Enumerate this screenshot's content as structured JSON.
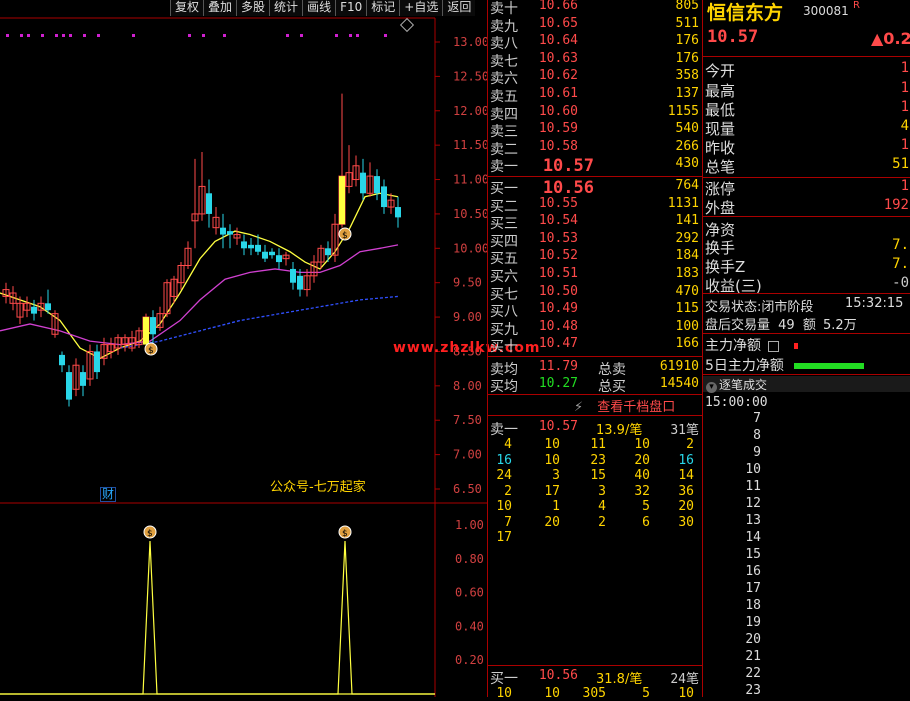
{
  "toolbar": {
    "buttons": [
      "复权",
      "叠加",
      "多股",
      "统计",
      "画线",
      "F10",
      "标记",
      "+自选",
      "返回"
    ]
  },
  "chart": {
    "y_ticks": [
      "13.00",
      "12.50",
      "12.00",
      "11.50",
      "11.00",
      "10.50",
      "10.00",
      "9.50",
      "9.00",
      "8.50",
      "8.00",
      "7.50",
      "7.00",
      "6.50"
    ],
    "indicator_ticks": [
      "1.00",
      "0.80",
      "0.60",
      "0.40",
      "0.20"
    ],
    "watermark": "公众号-七万起家",
    "caibadge": "财",
    "site_watermark": "www.zhzlkw.com"
  },
  "orderbook": {
    "asks": [
      {
        "label": "卖十",
        "price": "10.66",
        "vol": "805"
      },
      {
        "label": "卖九",
        "price": "10.65",
        "vol": "511"
      },
      {
        "label": "卖八",
        "price": "10.64",
        "vol": "176"
      },
      {
        "label": "卖七",
        "price": "10.63",
        "vol": "176"
      },
      {
        "label": "卖六",
        "price": "10.62",
        "vol": "358"
      },
      {
        "label": "卖五",
        "price": "10.61",
        "vol": "137"
      },
      {
        "label": "卖四",
        "price": "10.60",
        "vol": "1155"
      },
      {
        "label": "卖三",
        "price": "10.59",
        "vol": "540"
      },
      {
        "label": "卖二",
        "price": "10.58",
        "vol": "266"
      },
      {
        "label": "卖一",
        "price": "10.57",
        "vol": "430"
      }
    ],
    "bids": [
      {
        "label": "买一",
        "price": "10.56",
        "vol": "764"
      },
      {
        "label": "买二",
        "price": "10.55",
        "vol": "1131"
      },
      {
        "label": "买三",
        "price": "10.54",
        "vol": "141"
      },
      {
        "label": "买四",
        "price": "10.53",
        "vol": "292"
      },
      {
        "label": "买五",
        "price": "10.52",
        "vol": "184"
      },
      {
        "label": "买六",
        "price": "10.51",
        "vol": "183"
      },
      {
        "label": "买七",
        "price": "10.50",
        "vol": "470"
      },
      {
        "label": "买八",
        "price": "10.49",
        "vol": "115"
      },
      {
        "label": "买九",
        "price": "10.48",
        "vol": "100"
      },
      {
        "label": "买十",
        "price": "10.47",
        "vol": "166"
      }
    ],
    "ask_avg_label": "卖均",
    "ask_avg": "11.79",
    "total_sell_label": "总卖",
    "total_sell": "61910",
    "bid_avg_label": "买均",
    "bid_avg": "10.27",
    "total_buy_label": "总买",
    "total_buy": "14540",
    "thousand_button": "查看千档盘口",
    "queue_sell": {
      "label": "卖一",
      "price": "10.57",
      "per": "13.9/笔",
      "count": "31笔",
      "rows": [
        [
          "4",
          "10",
          "11",
          "10",
          "2"
        ],
        [
          "16",
          "10",
          "23",
          "20",
          "16"
        ],
        [
          "24",
          "3",
          "15",
          "40",
          "14"
        ],
        [
          "2",
          "17",
          "3",
          "32",
          "36"
        ],
        [
          "10",
          "1",
          "4",
          "5",
          "20"
        ],
        [
          "7",
          "20",
          "2",
          "6",
          "30"
        ],
        [
          "17",
          "",
          "",
          "",
          ""
        ]
      ]
    },
    "queue_buy": {
      "label": "买一",
      "price": "10.56",
      "per": "31.8/笔",
      "count": "24笔",
      "rows": [
        [
          "10",
          "10",
          "305",
          "5",
          "10"
        ]
      ]
    }
  },
  "quote": {
    "name": "恒信东方",
    "code": "300081",
    "flag": "R",
    "price": "10.57",
    "change": "▲0.2",
    "fields": [
      {
        "label": "今开",
        "value": "1"
      },
      {
        "label": "最高",
        "value": "1"
      },
      {
        "label": "最低",
        "value": "1"
      },
      {
        "label": "现量",
        "value": "4"
      },
      {
        "label": "昨收",
        "value": "1"
      },
      {
        "label": "总笔",
        "value": "51"
      },
      {
        "label": "涨停",
        "value": "1"
      },
      {
        "label": "外盘",
        "value": "192"
      },
      {
        "label": "净资",
        "value": ""
      },
      {
        "label": "换手",
        "value": "7."
      },
      {
        "label": "换手Z",
        "value": "7."
      },
      {
        "label": "收益(三)",
        "value": "-0"
      }
    ],
    "status_label": "交易状态:",
    "status": "闭市阶段",
    "status_time": "15:32:15",
    "after_label": "盘后交易量",
    "after_vol": "49",
    "after_amt_label": "额",
    "after_amt": "5.2万",
    "main_flow": "主力净额",
    "main_flow5": "5日主力净额",
    "tick_header": "逐笔成交",
    "tick_time": "15:00:00",
    "tick_numbers": [
      "7",
      "8",
      "9",
      "10",
      "11",
      "12",
      "13",
      "14",
      "15",
      "16",
      "17",
      "18",
      "19",
      "20",
      "21",
      "22",
      "23"
    ]
  },
  "colors": {
    "up": "#ff4a4a",
    "down": "#29d6e8",
    "ma5": "#ffff40",
    "ma10": "#d040d0",
    "ma20": "#3050ff"
  }
}
